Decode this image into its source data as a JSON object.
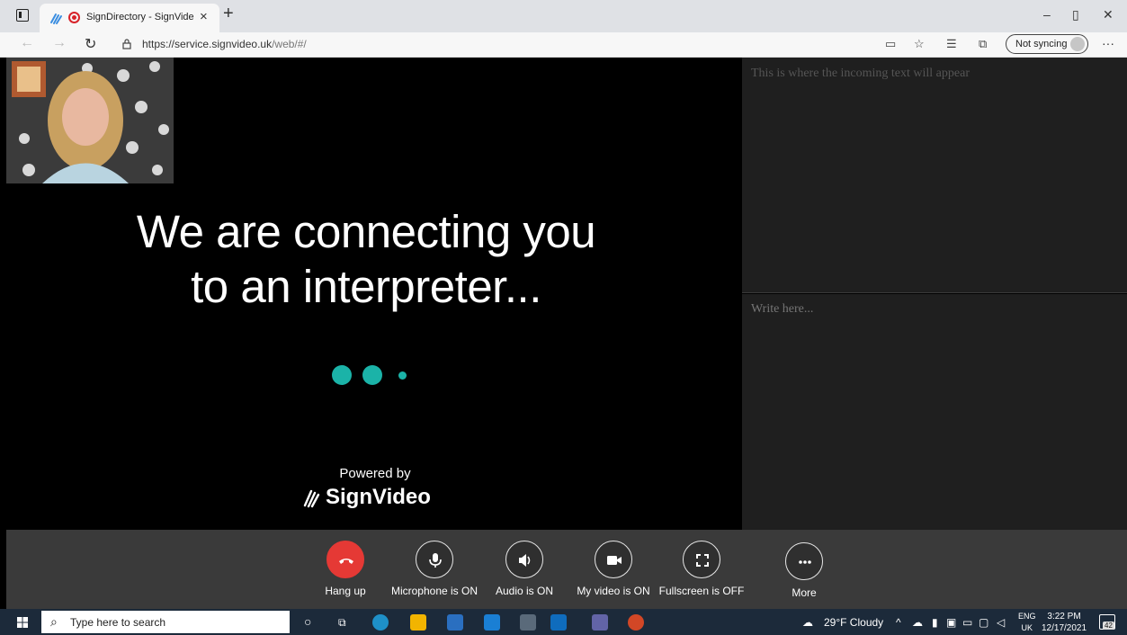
{
  "browser": {
    "tab_title": "SignDirectory - SignVideo W",
    "url_host": "https://service.signvideo.uk",
    "url_path": "/web/#/",
    "sync_label": "Not syncing"
  },
  "video": {
    "status_line1": "We are connecting you",
    "status_line2": "to an interpreter...",
    "powered_by": "Powered by",
    "brand": "SignVideo"
  },
  "text_panels": {
    "incoming_placeholder": "This is where the incoming text will appear",
    "write_placeholder": "Write here..."
  },
  "controls": [
    {
      "label": "Hang up",
      "icon": "phone-hangup-icon"
    },
    {
      "label": "Microphone is ON",
      "icon": "microphone-icon"
    },
    {
      "label": "Audio is ON",
      "icon": "speaker-icon"
    },
    {
      "label": "My video is ON",
      "icon": "video-camera-icon"
    },
    {
      "label": "Fullscreen is OFF",
      "icon": "fullscreen-icon"
    },
    {
      "label": "More",
      "icon": "more-icon"
    }
  ],
  "taskbar": {
    "search_placeholder": "Type here to search",
    "weather": "29°F  Cloudy",
    "lang_line1": "ENG",
    "lang_line2": "UK",
    "time": "3:22 PM",
    "date": "12/17/2021",
    "notifications": "42"
  },
  "colors": {
    "accent": "#1bb3a8",
    "hangup": "#e53935",
    "controls_bg": "#3a3a3a",
    "panel_bg": "#1f1f1f"
  }
}
